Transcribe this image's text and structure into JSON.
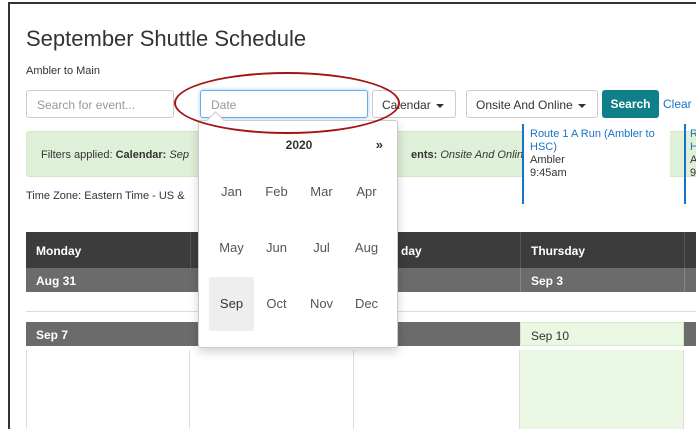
{
  "page": {
    "title": "September Shuttle Schedule",
    "subtitle": "Ambler to Main"
  },
  "toolbar": {
    "search_placeholder": "Search for event...",
    "date_placeholder": "Date",
    "calendar_label": "Calendar",
    "type_label": "Onsite And Online",
    "search_label": "Search",
    "clear_label": "Clear"
  },
  "filters": {
    "prefix": "Filters applied:",
    "calendar_key": "Calendar:",
    "calendar_value": "Sep",
    "events_suffix": "ents:",
    "events_value": "Onsite And Online"
  },
  "timezone": "Time Zone: Eastern Time - US &",
  "calendar": {
    "headers": [
      "Monday",
      "",
      "day",
      "Thursday"
    ],
    "week1": [
      "Aug 31",
      "",
      "",
      "Sep 3"
    ],
    "week2": [
      "Sep 7",
      "",
      "",
      "Sep 10"
    ],
    "event": {
      "name": "Route 1 A Run (Ambler to HSC)",
      "location": "Ambler",
      "time": "9:45am"
    },
    "event_partial": [
      "R",
      "H",
      "A",
      "9"
    ]
  },
  "picker": {
    "year": "2020",
    "prev": "«",
    "next": "»",
    "months": [
      "Jan",
      "Feb",
      "Mar",
      "Apr",
      "May",
      "Jun",
      "Jul",
      "Aug",
      "Sep",
      "Oct",
      "Nov",
      "Dec"
    ],
    "selected": "Sep"
  },
  "annotation_color": "#a31515",
  "accent_color": "#0f7f8a"
}
